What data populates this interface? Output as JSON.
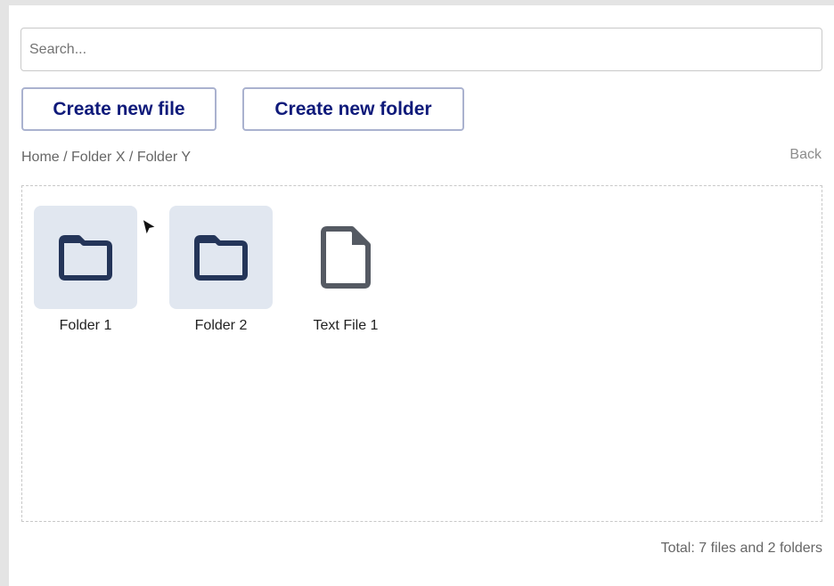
{
  "search": {
    "placeholder": "Search...",
    "value": ""
  },
  "toolbar": {
    "create_file_label": "Create new file",
    "create_folder_label": "Create new folder"
  },
  "breadcrumb": {
    "text": "Home / Folder X / Folder Y"
  },
  "back_label": "Back",
  "items": [
    {
      "label": "Folder 1",
      "icon": "folder-icon",
      "selected": true
    },
    {
      "label": "Folder 2",
      "icon": "folder-icon",
      "selected": true
    },
    {
      "label": "Text File 1",
      "icon": "file-icon",
      "selected": false
    }
  ],
  "footer": {
    "total": "Total: 7 files and 2 folders"
  },
  "colors": {
    "accent": "#0f1a7a",
    "folder_icon": "#243559",
    "file_icon": "#555a63",
    "tile_bg": "#e1e7f0"
  }
}
